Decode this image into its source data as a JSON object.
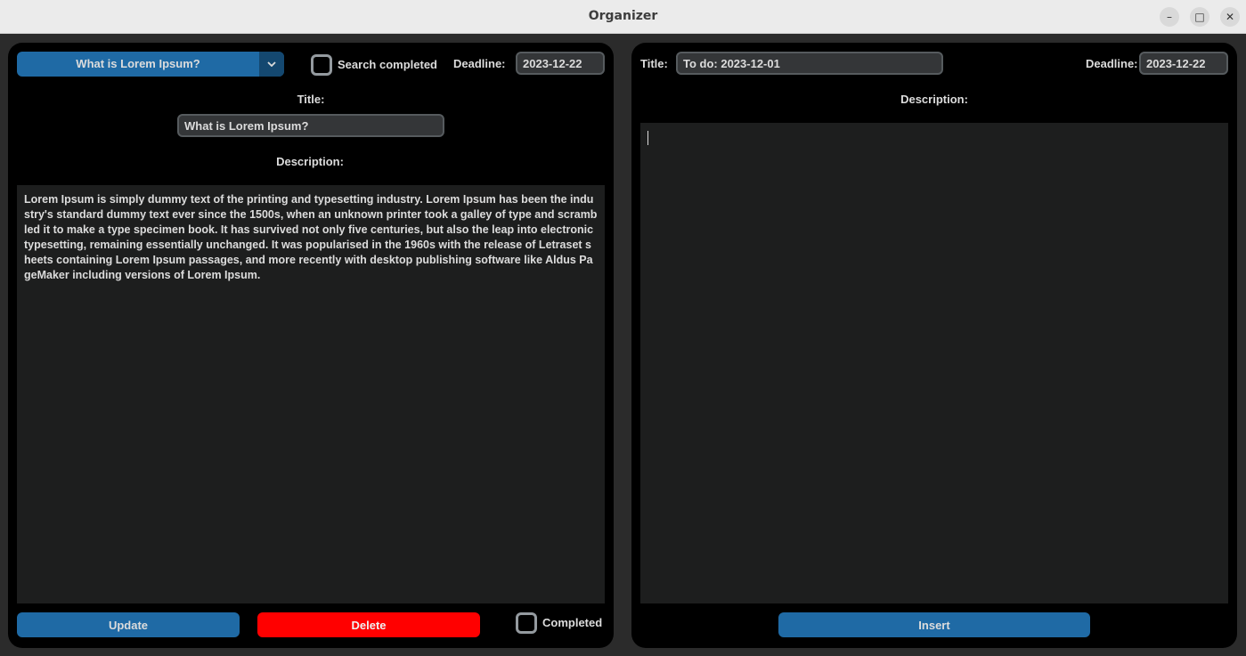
{
  "window": {
    "title": "Organizer",
    "controls": {
      "minimize": "–",
      "maximize": "□",
      "close": "✕"
    }
  },
  "left": {
    "dropdown": {
      "selected": "What is Lorem Ipsum?"
    },
    "search_completed_label": "Search completed",
    "deadline_label": "Deadline:",
    "deadline_value": "2023-12-22",
    "title_label": "Title:",
    "title_value": "What is Lorem Ipsum?",
    "description_label": "Description:",
    "description_text": "Lorem Ipsum is simply dummy text of the printing and typesetting industry. Lorem Ipsum has been the industry's standard dummy text ever since the 1500s, when an unknown printer took a galley of type and scrambled it to make a type specimen book. It has survived not only five centuries, but also the leap into electronic typesetting, remaining essentially unchanged. It was popularised in the 1960s with the release of Letraset sheets containing Lorem Ipsum passages, and more recently with desktop publishing software like Aldus PageMaker including versions of Lorem Ipsum.",
    "update_label": "Update",
    "delete_label": "Delete",
    "completed_label": "Completed"
  },
  "right": {
    "title_label": "Title:",
    "title_value": "To do: 2023-12-01",
    "deadline_label": "Deadline:",
    "deadline_value": "2023-12-22",
    "description_label": "Description:",
    "description_text": "",
    "insert_label": "Insert"
  },
  "colors": {
    "accent": "#1f6aa5",
    "accent_dark": "#144870",
    "danger": "#ff0000",
    "panel": "#000000",
    "background": "#2b2b2b",
    "textbox": "#1d1e1e"
  }
}
